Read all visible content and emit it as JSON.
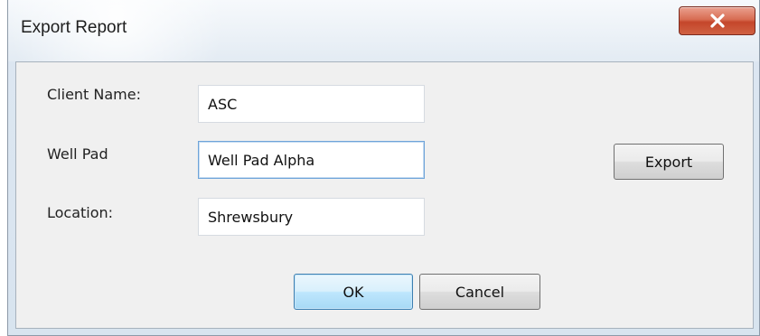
{
  "window": {
    "title": "Export Report",
    "close_label": "X"
  },
  "form": {
    "client_name_label": "Client Name:",
    "client_name_value": "ASC",
    "well_pad_label": "Well Pad",
    "well_pad_value": "Well Pad Alpha",
    "location_label": "Location:",
    "location_value": "Shrewsbury"
  },
  "buttons": {
    "export": "Export",
    "ok": "OK",
    "cancel": "Cancel"
  }
}
